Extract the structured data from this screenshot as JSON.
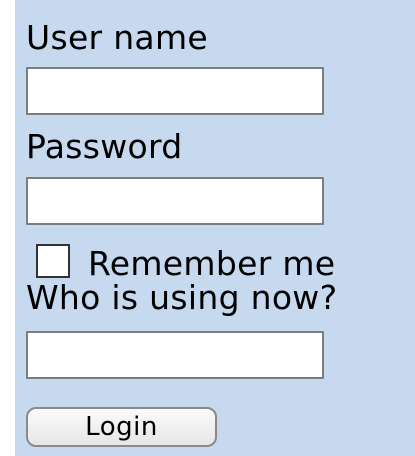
{
  "login_form": {
    "username_label": "User name",
    "username_value": "",
    "password_label": "Password",
    "password_value": "",
    "remember_label": "Remember me",
    "remember_checked": false,
    "who_label": "Who is using now?",
    "who_value": "",
    "login_button_label": "Login"
  },
  "colors": {
    "panel_background": "#c6d9ef",
    "field_border": "#7d7d7d"
  }
}
